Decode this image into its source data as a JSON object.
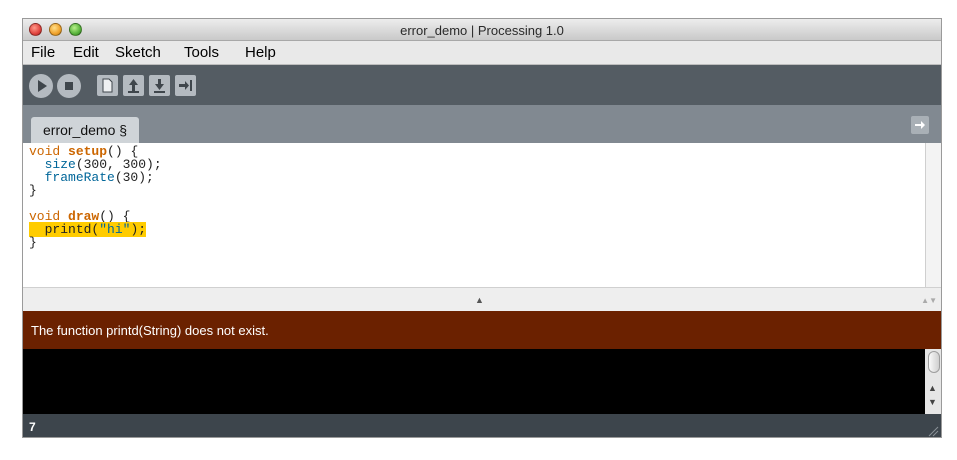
{
  "window": {
    "title": "error_demo | Processing 1.0"
  },
  "menubar": {
    "items": [
      "File",
      "Edit",
      "Sketch",
      "Tools",
      "Help"
    ]
  },
  "toolbar": {
    "buttons": [
      "run",
      "stop",
      "new",
      "open",
      "save",
      "export"
    ],
    "icons": [
      "play-icon",
      "stop-icon",
      "new-file-icon",
      "open-icon",
      "save-icon",
      "export-icon"
    ]
  },
  "tabs": [
    {
      "label": "error_demo §"
    }
  ],
  "editor": {
    "lines": [
      {
        "kw": "void",
        "fn": "setup",
        "rest": "() {"
      },
      {
        "api": "size",
        "rest": "(300, 300);"
      },
      {
        "api": "frameRate",
        "rest": "(30);"
      },
      {
        "rest": "}"
      },
      {
        "rest": ""
      },
      {
        "kw": "void",
        "fn": "draw",
        "rest": "() {"
      },
      {
        "text": "printd(",
        "str": "\"hi\"",
        "rest": ");"
      },
      {
        "rest": "}"
      }
    ]
  },
  "error": {
    "message": "The function printd(String) does not exist."
  },
  "status": {
    "line_number": "7"
  },
  "colors": {
    "toolbar": "#545c63",
    "tabbar": "#818991",
    "error_bar": "#6b2100",
    "console": "#000000",
    "status_bar": "#3d454c",
    "keyword": "#cc6600",
    "builtin": "#006699",
    "highlight": "#ffcc00"
  }
}
